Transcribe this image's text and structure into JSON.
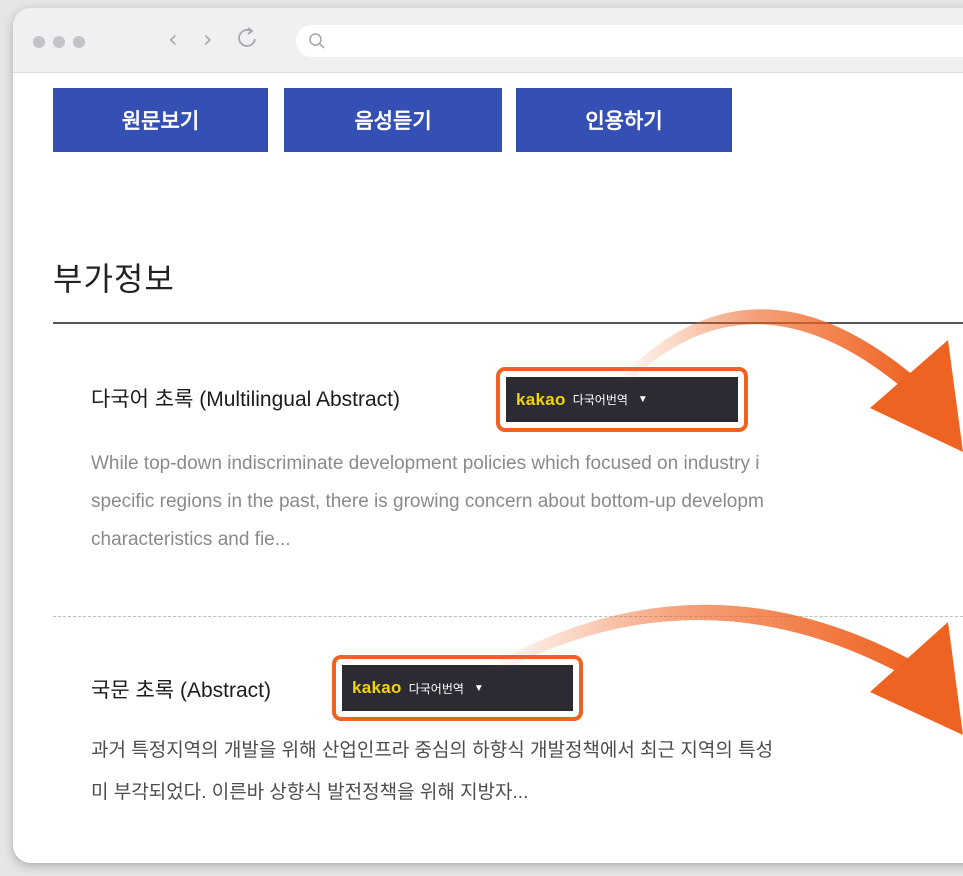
{
  "browser": {
    "back_icon": "chevron-left-icon",
    "forward_icon": "chevron-right-icon",
    "reload_icon": "reload-icon",
    "search_icon": "search-icon"
  },
  "toolbar": {
    "view_original": "원문보기",
    "listen_audio": "음성듣기",
    "cite": "인용하기"
  },
  "section": {
    "title": "부가정보"
  },
  "multilingual": {
    "heading": "다국어 초록 (Multilingual Abstract)",
    "body": "While top-down indiscriminate development policies which focused on industry i\nspecific regions in the past, there is growing concern about bottom-up developm\ncharacteristics and fie..."
  },
  "korean": {
    "heading": "국문 초록 (Abstract)",
    "body": "과거 특정지역의 개발을 위해 산업인프라 중심의 하향식 개발정책에서 최근 지역의 특성\n미 부각되었다. 이른바 상향식 발전정책을 위해 지방자..."
  },
  "translate": {
    "logo": "kakao",
    "label": "다국어번역",
    "caret": "▼"
  },
  "colors": {
    "button_bg": "#3550b4",
    "highlight": "#ef6322",
    "kakao_yellow": "#f5d300",
    "pill_bg": "#2b2b33"
  }
}
